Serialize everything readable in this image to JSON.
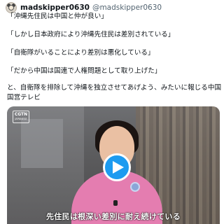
{
  "tweet": {
    "display_name": "madskipper0630",
    "handle": "@madskipper0630",
    "lines": [
      "「沖縄先住民は中国と仲が良い」",
      "「しかし日本政府により沖縄先住民は差別されている」",
      "「自衛隊がいることにより差別は悪化している」",
      "「だから中国は国連で人権問題として取り上げた」",
      "と、自衛隊を排除して沖縄を独立させてあげよう、みたいに報じる中国",
      "国営テレビ"
    ]
  },
  "video": {
    "logo_main": "CGTN",
    "logo_sub": "JAPANESE",
    "subtitle": "先住民は根深い差別に耐え続けている",
    "play_color": "#1d9bf0",
    "accent_dress": "#e47db0"
  },
  "icons": [
    "avatar",
    "cgtn-logo",
    "play-icon"
  ]
}
